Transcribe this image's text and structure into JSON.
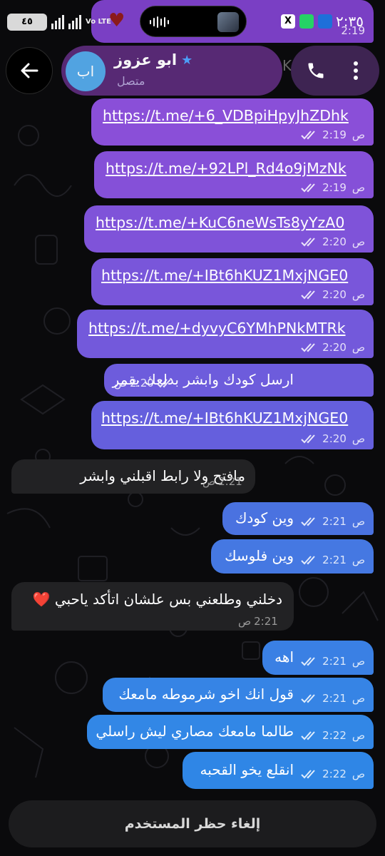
{
  "status_bar": {
    "time": "٢:٣٥",
    "battery": "٤٥",
    "network_label": "Vo LTE",
    "x_icon": "X"
  },
  "header": {
    "back_icon": "arrow-left-icon",
    "avatar_initials": "اب",
    "contact_name": "ابو عزوز",
    "verified_icon": "star-icon",
    "status": "متصل",
    "call_icon": "phone-icon",
    "menu_icon": "more-vertical-icon",
    "ghost_text": "K"
  },
  "theme": {
    "outgoing_top": "#8a4fd8",
    "outgoing_mid": "#6b5ce0",
    "outgoing_bottom": "#2f86e6",
    "incoming": "#222224",
    "header_pill": "#5a2a78",
    "avatar": "#54a8e8"
  },
  "messages": [
    {
      "dir": "out",
      "type": "link",
      "text": "https://t.me/+6_VDBpiHpyJhZDhk",
      "time": "2:19",
      "ampm": "ص"
    },
    {
      "dir": "out",
      "type": "link",
      "text": "https://t.me/+92LPl_Rd4o9jMzNk",
      "time": "2:19",
      "ampm": "ص"
    },
    {
      "dir": "out",
      "type": "link",
      "text": "https://t.me/+KuC6neWsTs8yYzA0",
      "time": "2:20",
      "ampm": "ص"
    },
    {
      "dir": "out",
      "type": "link",
      "text": "https://t.me/+IBt6hKUZ1MxjNGE0",
      "time": "2:20",
      "ampm": "ص"
    },
    {
      "dir": "out",
      "type": "link",
      "text": "https://t.me/+dyvyC6YMhPNkMTRk",
      "time": "2:20",
      "ampm": "ص"
    },
    {
      "dir": "out",
      "type": "text",
      "text": "ارسل كودك وابشر بدلعك يقمر",
      "time": "2:20",
      "ampm": "ص"
    },
    {
      "dir": "out",
      "type": "link",
      "text": "https://t.me/+IBt6hKUZ1MxjNGE0",
      "time": "2:20",
      "ampm": "ص"
    },
    {
      "dir": "in",
      "type": "text",
      "text": "مافتح ولا رابط اقبلني وابشر",
      "time": "2:21",
      "ampm": "ص"
    },
    {
      "dir": "out",
      "type": "text",
      "text": "وين كودك",
      "time": "2:21",
      "ampm": "ص"
    },
    {
      "dir": "out",
      "type": "text",
      "text": "وين فلوسك",
      "time": "2:21",
      "ampm": "ص"
    },
    {
      "dir": "in",
      "type": "text",
      "text": "دخلني وطلعني بس علشان اتأكد ياحبي ❤️",
      "time": "2:21",
      "ampm": "ص"
    },
    {
      "dir": "out",
      "type": "text",
      "text": "اهه",
      "time": "2:21",
      "ampm": "ص"
    },
    {
      "dir": "out",
      "type": "text",
      "text": "قول انك اخو شرموطه مامعك",
      "time": "2:21",
      "ampm": "ص"
    },
    {
      "dir": "out",
      "type": "text",
      "text": "طالما مامعك مصاري ليش راسلي",
      "time": "2:22",
      "ampm": "ص"
    },
    {
      "dir": "out",
      "type": "text",
      "text": "انقلع يخو القحبه",
      "time": "2:22",
      "ampm": "ص"
    }
  ],
  "top_partial_time": "2:19",
  "unblock_button": "إلغاء حظر المستخدم"
}
